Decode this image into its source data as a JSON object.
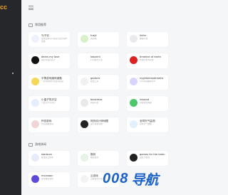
{
  "logo": "cc",
  "sections": [
    {
      "title": "常用推荐"
    },
    {
      "title": "游戏休闲"
    }
  ],
  "cards": [
    {
      "title": "与子也",
      "desc": "这款应用可以满足大部分用户需求",
      "icon": "cn-red"
    },
    {
      "title": "tusiji",
      "desc": "资源站",
      "icon": "leaf-icon"
    },
    {
      "title": "iinfer",
      "desc": "推理平台",
      "icon": "circle-icon"
    },
    {
      "title": "dears my love",
      "desc": "情侣专属纪念日",
      "icon": "black-circle"
    },
    {
      "title": "idaprint",
      "desc": "打印服务平台",
      "icon": "bird-icon"
    },
    {
      "title": "timeline of earth",
      "desc": "地球历史时间线",
      "icon": "earth-icon"
    },
    {
      "title": "平等游戏媒体道路",
      "desc": "一款免费的开源游戏资源",
      "icon": "yellow-icon"
    },
    {
      "title": "gadaris",
      "desc": "在线工具",
      "icon": "g-icon"
    },
    {
      "title": "nyghtsleepdreams",
      "desc": "与AI共度睡前时光",
      "icon": "dream-icon"
    },
    {
      "title": "小盒子的天空",
      "desc": "小盒子分享天空",
      "icon": "blue-icon"
    },
    {
      "title": "bookreas",
      "desc": "阅读平台",
      "icon": "book-icon"
    },
    {
      "title": "napsnd",
      "desc": "白噪音生成器",
      "icon": "green-icon"
    },
    {
      "title": "怀旧游戏",
      "desc": "怀旧经典游戏",
      "icon": "car-icon"
    },
    {
      "title": "网页设计师地图",
      "desc": "设计资源导航",
      "icon": "map-icon"
    },
    {
      "title": "全球天气监测",
      "desc": "实时天气数据",
      "icon": "weather-icon"
    }
  ],
  "game_cards": [
    {
      "title": "starbum",
      "desc": "在线星空体验",
      "icon": "star-icon"
    },
    {
      "title": "数码",
      "desc": "数码游戏",
      "icon": "digit-icon"
    },
    {
      "title": "games for the brain",
      "desc": "益智小游戏",
      "icon": "brain-icon"
    },
    {
      "title": "monsoon",
      "desc": "在线放置游戏",
      "icon": "m-icon"
    },
    {
      "title": "云游戏",
      "desc": "云端游戏平台",
      "icon": "cloud-icon"
    }
  ],
  "watermark": {
    "num": "008",
    "text": "导航"
  },
  "colors": {
    "accent": "#1d62c9",
    "logo": "#f0a326",
    "sidebar": "#26272b"
  }
}
